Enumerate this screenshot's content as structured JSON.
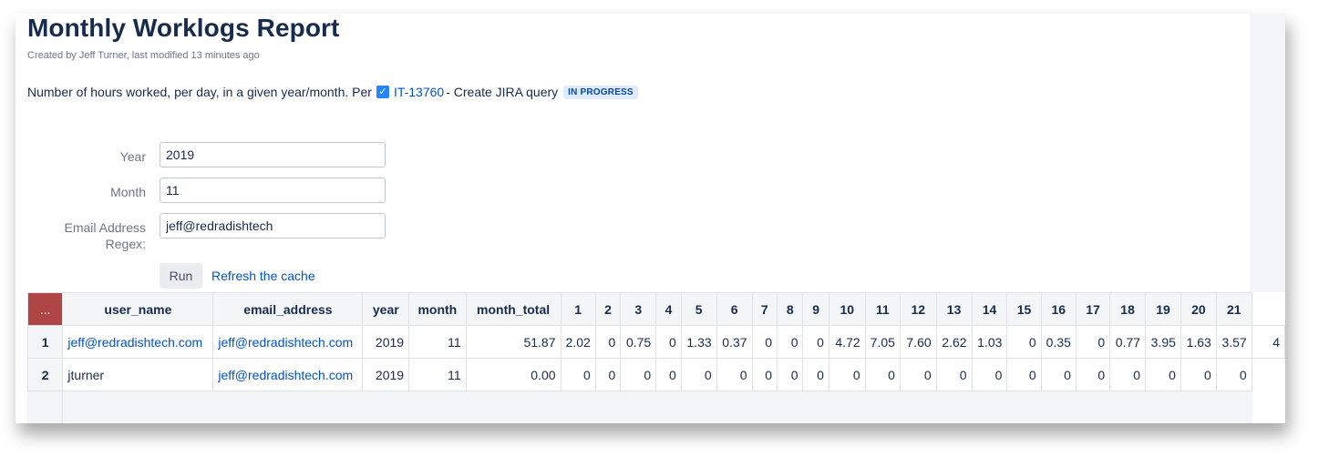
{
  "page": {
    "title": "Monthly Worklogs Report",
    "byline": "Created by Jeff Turner, last modified 13 minutes ago",
    "description_prefix": "Number of hours worked, per day, in a given year/month. Per",
    "issue_key": "IT-13760",
    "issue_summary": "- Create JIRA query",
    "issue_status": "IN PROGRESS",
    "checkbox_glyph": "✓"
  },
  "form": {
    "year_label": "Year",
    "year_value": "2019",
    "month_label": "Month",
    "month_value": "11",
    "email_label_line1": "Email Address",
    "email_label_line2": "Regex:",
    "email_value": "jeff@redradishtech",
    "run_label": "Run",
    "refresh_label": "Refresh the cache"
  },
  "table": {
    "corner_label": "...",
    "headers": [
      "user_name",
      "email_address",
      "year",
      "month",
      "month_total",
      "1",
      "2",
      "3",
      "4",
      "5",
      "6",
      "7",
      "8",
      "9",
      "10",
      "11",
      "12",
      "13",
      "14",
      "15",
      "16",
      "17",
      "18",
      "19",
      "20",
      "21"
    ],
    "rows": [
      {
        "num": "1",
        "user_name": "jeff@redradishtech.com",
        "user_is_link": true,
        "email_address": "jeff@redradishtech.com",
        "year": "2019",
        "month": "11",
        "month_total": "51.87",
        "days": [
          "2.02",
          "0",
          "0.75",
          "0",
          "1.33",
          "0.37",
          "0",
          "0",
          "0",
          "4.72",
          "7.05",
          "7.60",
          "2.62",
          "1.03",
          "0",
          "0.35",
          "0",
          "0.77",
          "3.95",
          "1.63",
          "3.57",
          "4"
        ]
      },
      {
        "num": "2",
        "user_name": "jturner",
        "user_is_link": false,
        "email_address": "jeff@redradishtech.com",
        "year": "2019",
        "month": "11",
        "month_total": "0.00",
        "days": [
          "0",
          "0",
          "0",
          "0",
          "0",
          "0",
          "0",
          "0",
          "0",
          "0",
          "0",
          "0",
          "0",
          "0",
          "0",
          "0",
          "0",
          "0",
          "0",
          "0",
          "0"
        ]
      }
    ]
  },
  "colors": {
    "corner_header": "#b04545",
    "link": "#0052cc",
    "lozenge_bg": "#deebff",
    "lozenge_text": "#0747a6",
    "checkbox": "#2684ff"
  }
}
